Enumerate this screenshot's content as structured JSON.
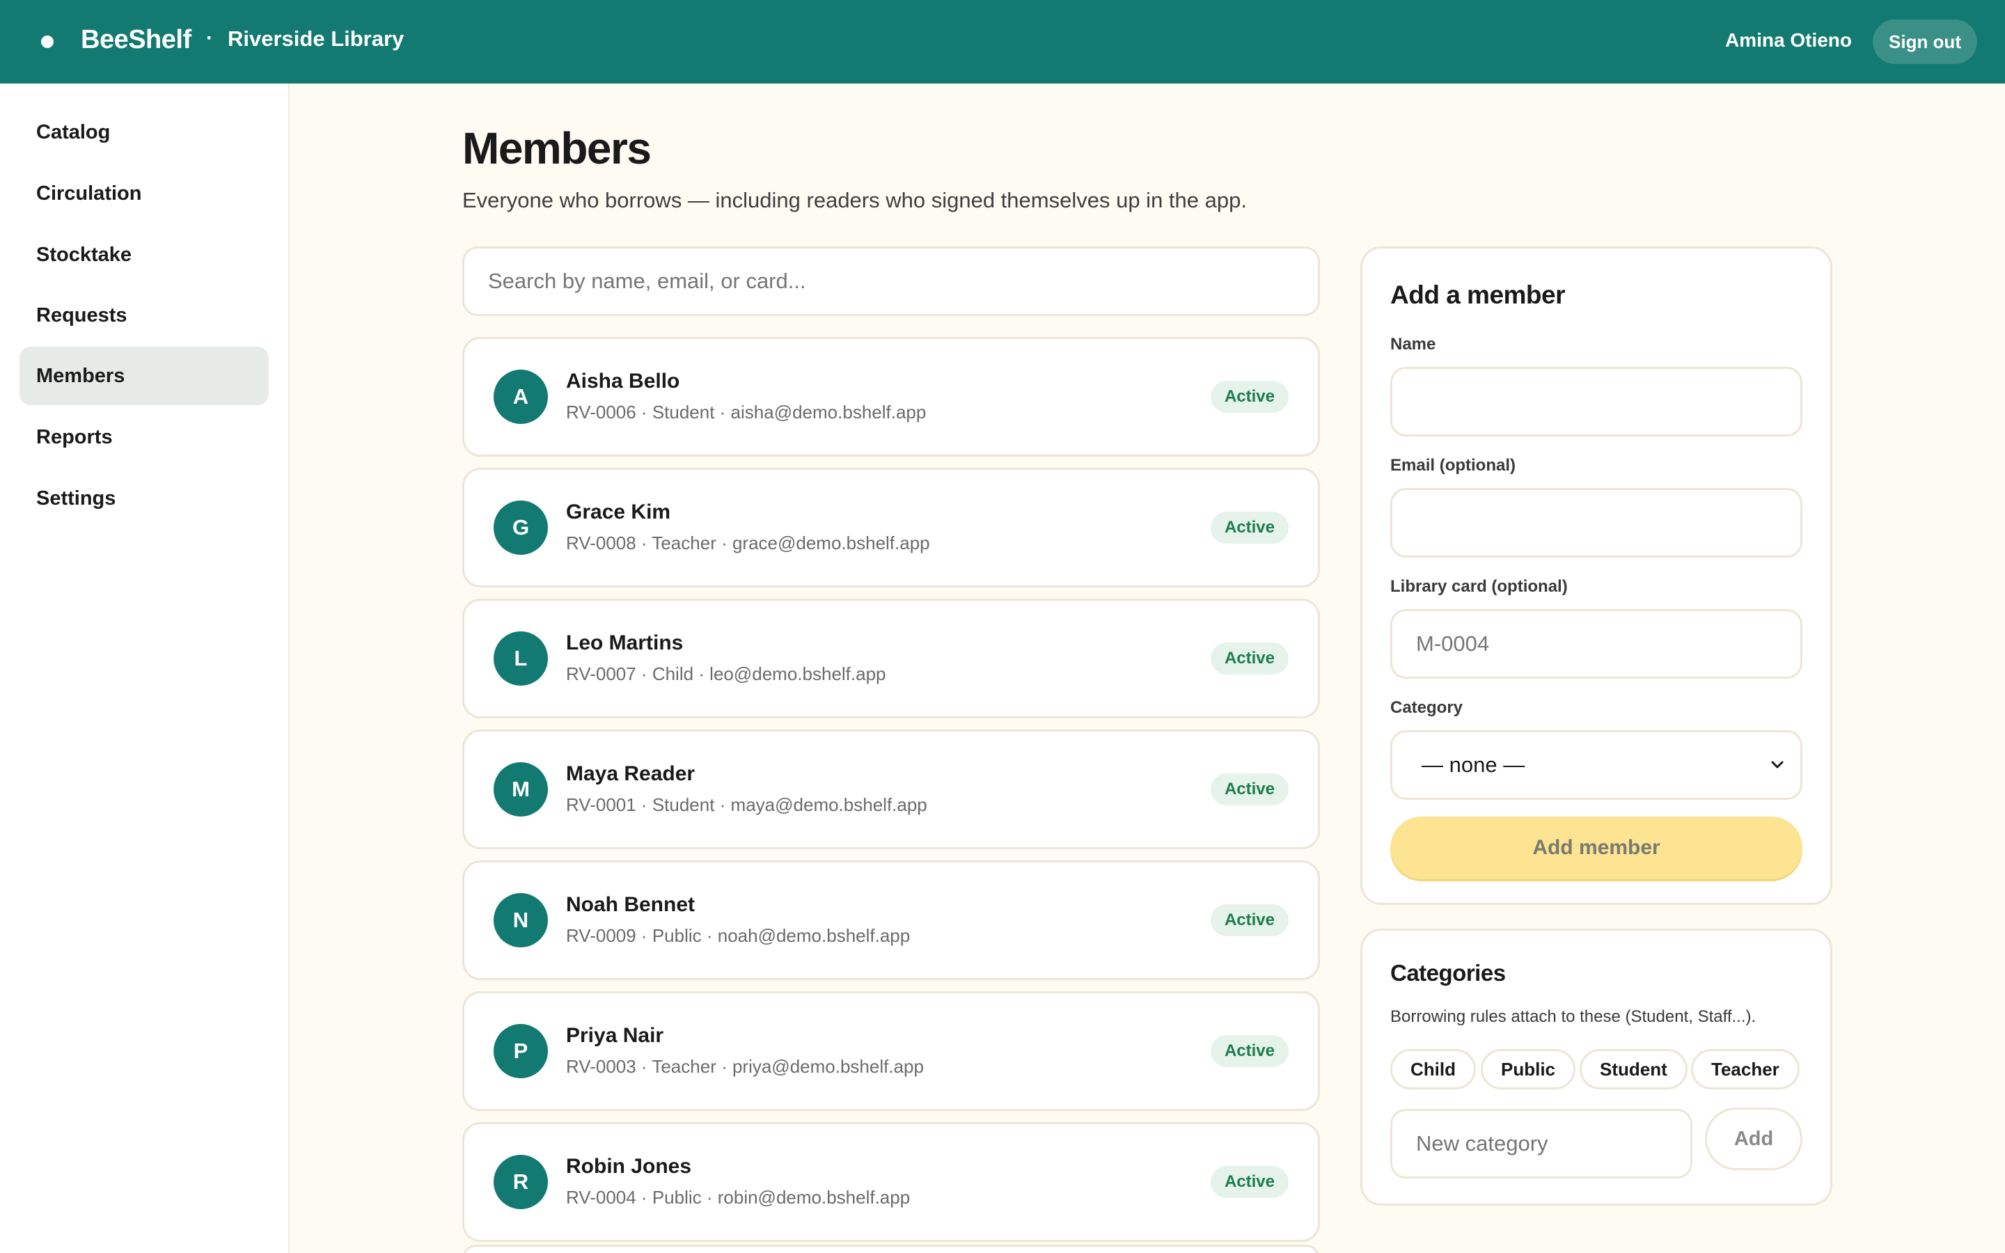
{
  "header": {
    "brand": "BeeShelf",
    "separator": "·",
    "library": "Riverside Library",
    "user": "Amina Otieno",
    "sign_out": "Sign out"
  },
  "sidebar": {
    "items": [
      {
        "label": "Catalog",
        "active": false
      },
      {
        "label": "Circulation",
        "active": false
      },
      {
        "label": "Stocktake",
        "active": false
      },
      {
        "label": "Requests",
        "active": false
      },
      {
        "label": "Members",
        "active": true
      },
      {
        "label": "Reports",
        "active": false
      },
      {
        "label": "Settings",
        "active": false
      }
    ]
  },
  "main": {
    "title": "Members",
    "subtitle": "Everyone who borrows — including readers who signed themselves up in the app.",
    "search_placeholder": "Search by name, email, or card..."
  },
  "members": [
    {
      "initial": "A",
      "name": "Aisha Bello",
      "meta": "RV-0006 · Student · aisha@demo.bshelf.app",
      "status": "Active"
    },
    {
      "initial": "G",
      "name": "Grace Kim",
      "meta": "RV-0008 · Teacher · grace@demo.bshelf.app",
      "status": "Active"
    },
    {
      "initial": "L",
      "name": "Leo Martins",
      "meta": "RV-0007 · Child · leo@demo.bshelf.app",
      "status": "Active"
    },
    {
      "initial": "M",
      "name": "Maya Reader",
      "meta": "RV-0001 · Student · maya@demo.bshelf.app",
      "status": "Active"
    },
    {
      "initial": "N",
      "name": "Noah Bennet",
      "meta": "RV-0009 · Public · noah@demo.bshelf.app",
      "status": "Active"
    },
    {
      "initial": "P",
      "name": "Priya Nair",
      "meta": "RV-0003 · Teacher · priya@demo.bshelf.app",
      "status": "Active"
    },
    {
      "initial": "R",
      "name": "Robin Jones",
      "meta": "RV-0004 · Public · robin@demo.bshelf.app",
      "status": "Active"
    }
  ],
  "add_member": {
    "title": "Add a member",
    "name_label": "Name",
    "name_value": "",
    "email_label": "Email (optional)",
    "email_value": "",
    "card_label": "Library card (optional)",
    "card_placeholder": "M-0004",
    "category_label": "Category",
    "category_selected": "— none —",
    "submit": "Add member"
  },
  "categories": {
    "title": "Categories",
    "description": "Borrowing rules attach to these (Student, Staff...).",
    "items": [
      "Child",
      "Public",
      "Student",
      "Teacher"
    ],
    "new_placeholder": "New category",
    "add": "Add"
  },
  "colors": {
    "brand": "#127a70",
    "background": "#fdfbf2",
    "accent_button": "#fce493",
    "status_active": "#1e7d4c"
  }
}
